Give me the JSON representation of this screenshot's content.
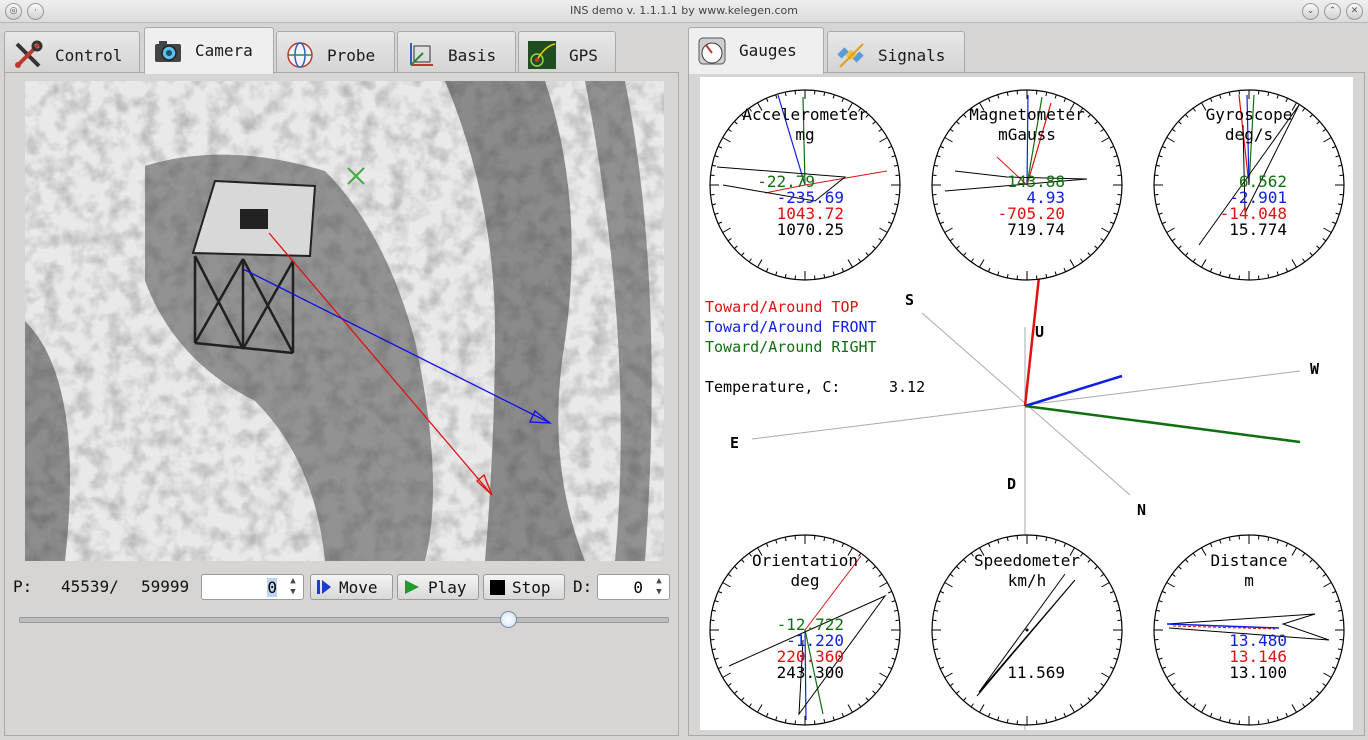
{
  "window": {
    "title": "INS demo v. 1.1.1.1 by www.kelegen.com"
  },
  "left_tabs": [
    {
      "label": "Control",
      "icon": "tools-icon"
    },
    {
      "label": "Camera",
      "icon": "camera-icon"
    },
    {
      "label": "Probe",
      "icon": "globe-icon"
    },
    {
      "label": "Basis",
      "icon": "axes-icon"
    },
    {
      "label": "GPS",
      "icon": "gps-icon"
    }
  ],
  "right_tabs": [
    {
      "label": "Gauges",
      "icon": "gauge-icon"
    },
    {
      "label": "Signals",
      "icon": "satellite-icon"
    }
  ],
  "camera_controls": {
    "p_label": "P:",
    "position": "45539/",
    "total": "59999",
    "step_value": "0",
    "move_label": "Move",
    "play_label": "Play",
    "stop_label": "Stop",
    "d_label": "D:",
    "d_value": "0",
    "slider_fraction": 0.759
  },
  "colors": {
    "top": "#ff0000",
    "front": "#0000ee",
    "right": "#007700",
    "magnitude": "#000000"
  },
  "gauges": {
    "accelerometer": {
      "title": "Accelerometer",
      "unit": "mg",
      "right": "-22.79",
      "front": "-235.69",
      "top": "1043.72",
      "magnitude": "1070.25"
    },
    "magnetometer": {
      "title": "Magnetometer",
      "unit": "mGauss",
      "right": "143.88",
      "front": "4.93",
      "top": "-705.20",
      "magnitude": "719.74"
    },
    "gyroscope": {
      "title": "Gyroscope",
      "unit": "deg/s",
      "right": "6.562",
      "front": "-2.901",
      "top": "-14.048",
      "magnitude": "15.774"
    },
    "orientation": {
      "title": "Orientation",
      "unit": "deg",
      "right": "-12.722",
      "front": "-1.220",
      "top": "220.360",
      "magnitude": "243.300"
    },
    "speedometer": {
      "title": "Speedometer",
      "unit": "km/h",
      "magnitude": "11.569"
    },
    "distance": {
      "title": "Distance",
      "unit": "m",
      "front": "13.480",
      "top": "13.146",
      "magnitude": "13.100"
    }
  },
  "legend": {
    "top": "Toward/Around TOP",
    "front": "Toward/Around FRONT",
    "right": "Toward/Around RIGHT"
  },
  "temperature": {
    "label": "Temperature, C:",
    "value": "3.12"
  },
  "axes": {
    "s": "S",
    "u": "U",
    "w": "W",
    "e": "E",
    "d": "D",
    "n": "N"
  }
}
